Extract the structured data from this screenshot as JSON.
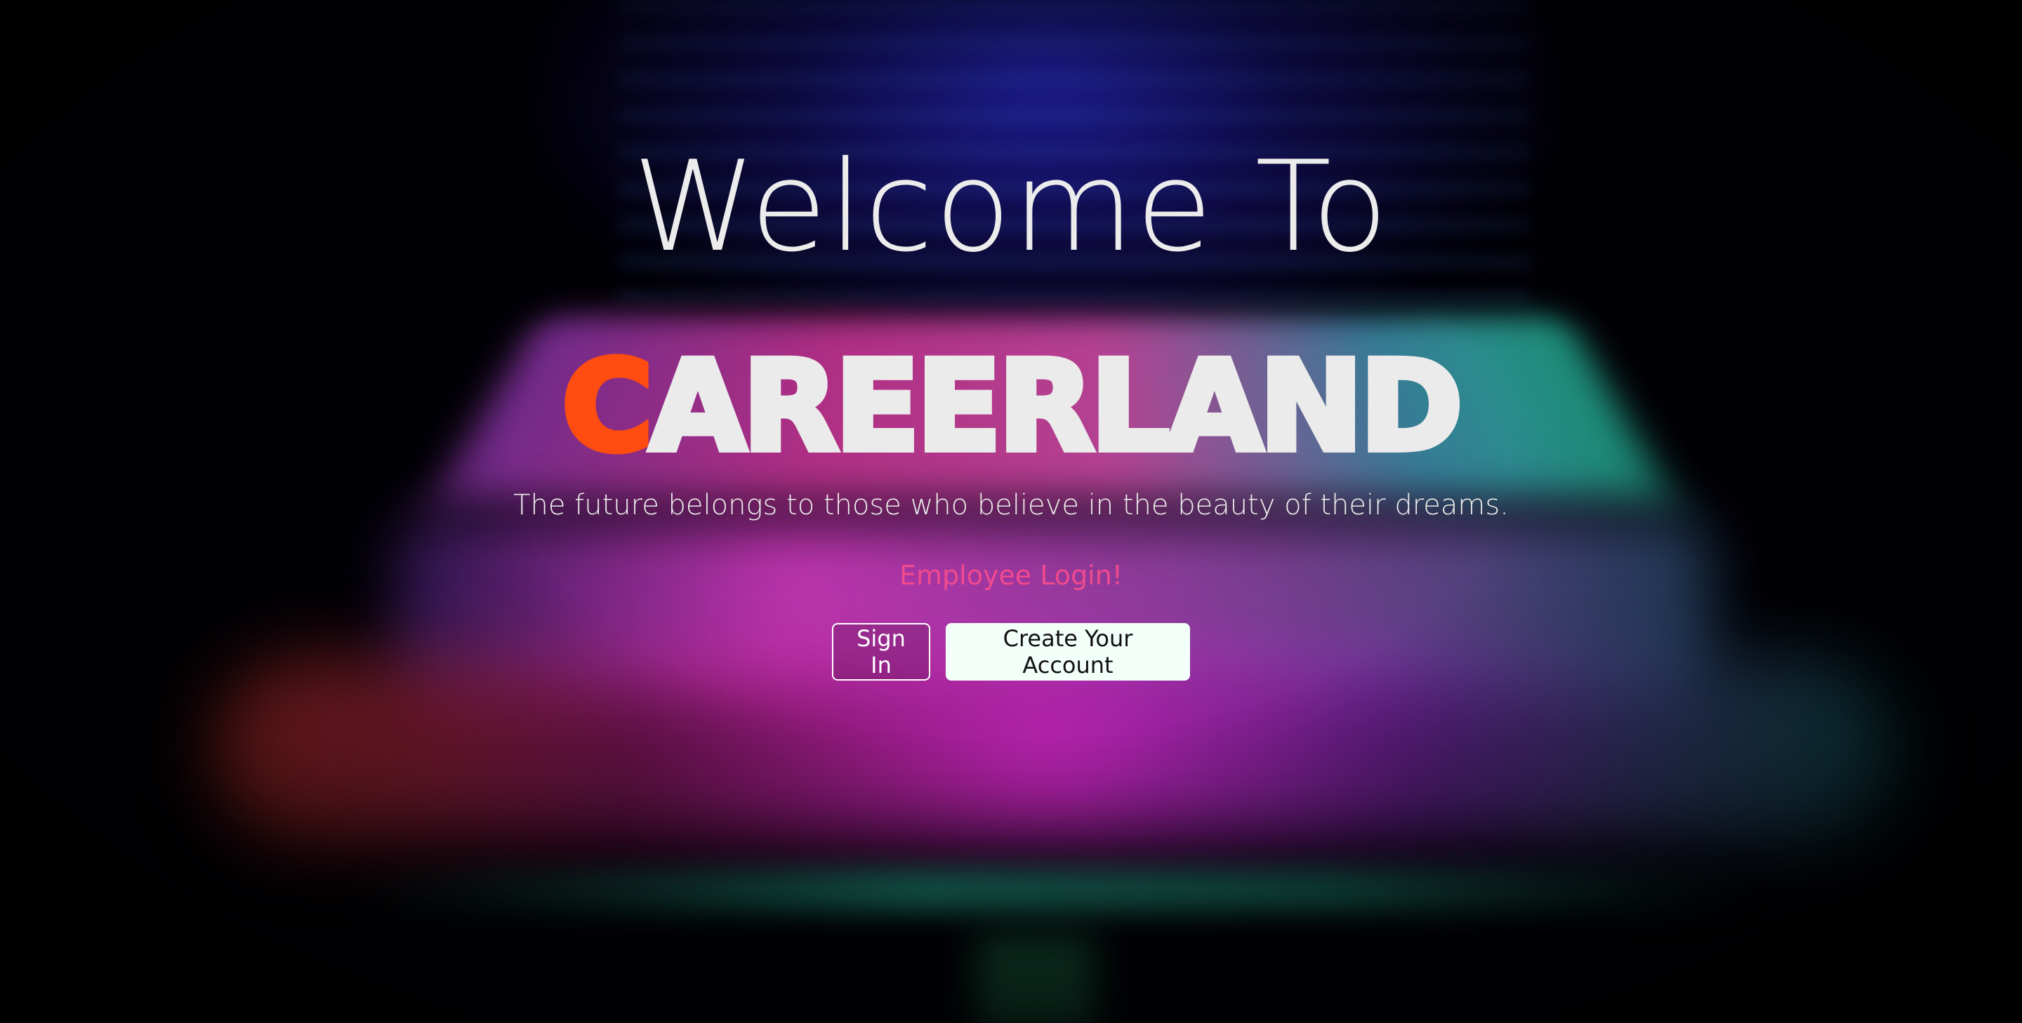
{
  "hero": {
    "welcome_text": "Welcome To",
    "brand_first_letter": "C",
    "brand_rest": "AREERLAND",
    "tagline": "The future belongs to those who believe in the beauty of their dreams.",
    "employee_login": "Employee Login!"
  },
  "actions": {
    "sign_in_label": "Sign In",
    "create_account_label": "Create Your Account"
  },
  "colors": {
    "brand_accent": "#ff4c10",
    "employee_login": "#f04a8e",
    "text_light": "#ececec",
    "create_button_bg": "#f3fff9"
  }
}
